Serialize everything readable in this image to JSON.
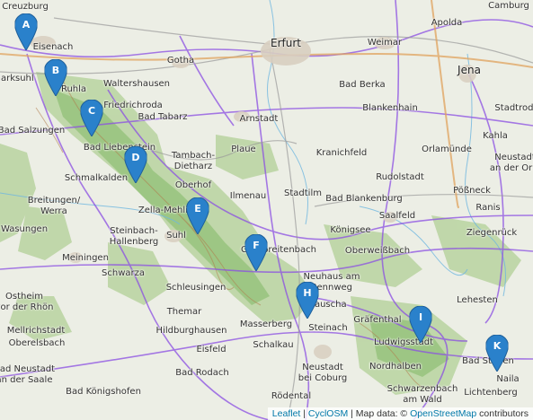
{
  "places": [
    {
      "id": "creuzburg",
      "name": "Creuzburg"
    },
    {
      "id": "apolda",
      "name": "Apolda"
    },
    {
      "id": "camburg",
      "name": "Camburg"
    },
    {
      "id": "eisenach",
      "name": "Eisenach"
    },
    {
      "id": "erfurt",
      "name": "Erfurt"
    },
    {
      "id": "weimar",
      "name": "Weimar"
    },
    {
      "id": "gotha",
      "name": "Gotha"
    },
    {
      "id": "jena",
      "name": "Jena"
    },
    {
      "id": "marksuhl",
      "name": "Marksuhl"
    },
    {
      "id": "ruhla",
      "name": "Ruhla"
    },
    {
      "id": "waltershausen",
      "name": "Waltershausen"
    },
    {
      "id": "bad-berka",
      "name": "Bad Berka"
    },
    {
      "id": "friedrichroda",
      "name": "Friedrichroda"
    },
    {
      "id": "bad-tabarz",
      "name": "Bad Tabarz"
    },
    {
      "id": "arnstadt",
      "name": "Arnstadt"
    },
    {
      "id": "blankenhain",
      "name": "Blankenhain"
    },
    {
      "id": "bad-salzungen",
      "name": "Bad Salzungen"
    },
    {
      "id": "bad-liebenstein",
      "name": "Bad Liebenstein"
    },
    {
      "id": "plaue",
      "name": "Plaue"
    },
    {
      "id": "tambach",
      "name": "Tambach-\nDietharz"
    },
    {
      "id": "kranichfeld",
      "name": "Kranichfeld"
    },
    {
      "id": "kahla",
      "name": "Kahla"
    },
    {
      "id": "orlamuende",
      "name": "Orlamünde"
    },
    {
      "id": "stadtroda",
      "name": "Stadtroda"
    },
    {
      "id": "neustadt-orla",
      "name": "Neustadt\nan der Orla"
    },
    {
      "id": "schmalkalden",
      "name": "Schmalkalden"
    },
    {
      "id": "rudolstadt",
      "name": "Rudolstadt"
    },
    {
      "id": "oberhof",
      "name": "Oberhof"
    },
    {
      "id": "ilmenau",
      "name": "Ilmenau"
    },
    {
      "id": "stadtilm",
      "name": "Stadtilm"
    },
    {
      "id": "bad-blankenburg",
      "name": "Bad Blankenburg"
    },
    {
      "id": "poessneck",
      "name": "Pößneck"
    },
    {
      "id": "breitungen",
      "name": "Breitungen/\nWerra"
    },
    {
      "id": "zella-mehlis",
      "name": "Zella-Mehlis"
    },
    {
      "id": "saalfeld",
      "name": "Saalfeld"
    },
    {
      "id": "ranis",
      "name": "Ranis"
    },
    {
      "id": "wasungen",
      "name": "Wasungen"
    },
    {
      "id": "steinbach-hallenberg",
      "name": "Steinbach-\nHallenberg"
    },
    {
      "id": "suhl",
      "name": "Suhl"
    },
    {
      "id": "koenigsee",
      "name": "Königsee"
    },
    {
      "id": "ziegenrueck",
      "name": "Ziegenrück"
    },
    {
      "id": "meiningen",
      "name": "Meiningen"
    },
    {
      "id": "grossbreitenbach",
      "name": "Großbreitenbach"
    },
    {
      "id": "oberweissbach",
      "name": "Oberweißbach"
    },
    {
      "id": "schwarza",
      "name": "Schwarza"
    },
    {
      "id": "schleusingen",
      "name": "Schleusingen"
    },
    {
      "id": "neuhaus",
      "name": "Neuhaus am\nRennweg"
    },
    {
      "id": "ostheim",
      "name": "Ostheim\nvor der Rhön"
    },
    {
      "id": "themar",
      "name": "Themar"
    },
    {
      "id": "lauscha",
      "name": "Lauscha"
    },
    {
      "id": "graefenthal",
      "name": "Gräfenthal"
    },
    {
      "id": "lehesten",
      "name": "Lehesten"
    },
    {
      "id": "mellrichstadt",
      "name": "Mellrichstadt"
    },
    {
      "id": "hildburghausen",
      "name": "Hildburghausen"
    },
    {
      "id": "masserberg",
      "name": "Masserberg"
    },
    {
      "id": "steinach",
      "name": "Steinach"
    },
    {
      "id": "ludwigsstadt",
      "name": "Ludwigsstadt"
    },
    {
      "id": "oberelsbach",
      "name": "Oberelsbach"
    },
    {
      "id": "schalkau",
      "name": "Schalkau"
    },
    {
      "id": "eisfeld",
      "name": "Eisfeld"
    },
    {
      "id": "nordhalben",
      "name": "Nordhalben"
    },
    {
      "id": "bad-steben",
      "name": "Bad Steben"
    },
    {
      "id": "bad-neustadt",
      "name": "Bad Neustadt\nan der Saale"
    },
    {
      "id": "bad-rodach",
      "name": "Bad Rodach"
    },
    {
      "id": "neustadt-coburg",
      "name": "Neustadt\nbei Coburg"
    },
    {
      "id": "naila",
      "name": "Naila"
    },
    {
      "id": "bad-koenigshofen",
      "name": "Bad Königshofen"
    },
    {
      "id": "schwarzenbach",
      "name": "Schwarzenbach\nam Wald"
    },
    {
      "id": "lichtenberg",
      "name": "Lichtenberg"
    },
    {
      "id": "roedental",
      "name": "Rödental"
    }
  ],
  "markers": [
    "A",
    "B",
    "C",
    "D",
    "E",
    "F",
    "H",
    "I",
    "K"
  ],
  "marker_color": "#2a81cb",
  "attribution": {
    "leaflet": "Leaflet",
    "sep1": " | ",
    "cyclosm": "CyclOSM",
    "sep2": " | Map data: © ",
    "osm": "OpenStreetMap",
    "tail": " contributors"
  }
}
